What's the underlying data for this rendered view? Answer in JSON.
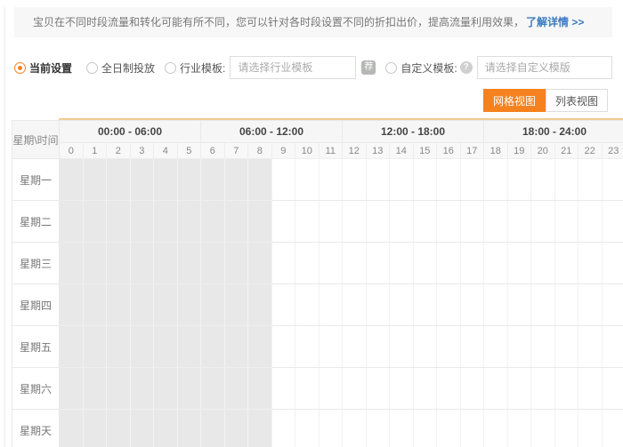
{
  "banner": {
    "text": "宝贝在不同时段流量和转化可能有所不同，您可以针对各时段设置不同的折扣出价，提高流量利用效果，",
    "link": "了解详情 >>"
  },
  "options": {
    "radios": [
      {
        "label": "当前设置",
        "selected": true
      },
      {
        "label": "全日制投放",
        "selected": false
      },
      {
        "label": "行业模板:",
        "selected": false,
        "placeholder": "请选择行业模板"
      },
      {
        "label": "自定义模板:",
        "selected": false,
        "placeholder": "请选择自定义模版"
      }
    ],
    "badge": "荐",
    "help": "?"
  },
  "view_toggle": {
    "grid": "网格视图",
    "list": "列表视图",
    "active": "网格视图"
  },
  "schedule": {
    "corner": "星期\\时间",
    "blocks": [
      "00:00 - 06:00",
      "06:00 - 12:00",
      "12:00 - 18:00",
      "18:00 - 24:00"
    ],
    "hours": [
      0,
      1,
      2,
      3,
      4,
      5,
      6,
      7,
      8,
      9,
      10,
      11,
      12,
      13,
      14,
      15,
      16,
      17,
      18,
      19,
      20,
      21,
      22,
      23
    ],
    "days": [
      "星期一",
      "星期二",
      "星期三",
      "星期四",
      "星期五",
      "星期六",
      "星期天"
    ],
    "filled": {
      "hour_start": 0,
      "hour_end": 8,
      "days": "all"
    }
  },
  "colors": {
    "accent_orange": "#f5821f",
    "link_blue": "#3a7bbf",
    "topline_tan": "#f3cb92",
    "filled_cell": "#e8e8e8",
    "header_bg": "#f6f6f6"
  }
}
